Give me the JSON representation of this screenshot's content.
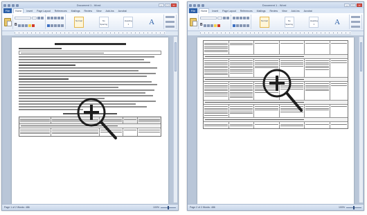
{
  "windows": [
    {
      "title": "Document 1 - Word",
      "file_tab": "File",
      "tabs": [
        "Home",
        "Insert",
        "Page Layout",
        "References",
        "Mailings",
        "Review",
        "View",
        "Add-Ins",
        "Acrobat"
      ],
      "styles": [
        "Normal",
        "No Spacing",
        "Heading 1"
      ],
      "find_label": "A",
      "status": "Page 1 of 2   Words: 486",
      "zoom": "100%",
      "magnifier_icon": "zoom-in-magnifier-icon"
    },
    {
      "title": "Document 1 - Word",
      "file_tab": "File",
      "tabs": [
        "Home",
        "Insert",
        "Page Layout",
        "References",
        "Mailings",
        "Review",
        "View",
        "Add-Ins",
        "Acrobat"
      ],
      "styles": [
        "Normal",
        "No Spacing",
        "Heading 1"
      ],
      "find_label": "A",
      "status": "Page 2 of 2   Words: 486",
      "zoom": "100%",
      "magnifier_icon": "zoom-in-magnifier-icon"
    }
  ],
  "colors": {
    "file_tab": "#2b5fa8",
    "ribbon_bg": "#e4ecf7",
    "workspace_bg": "#b9c6d8",
    "magnifier": "#1e1e1e"
  }
}
